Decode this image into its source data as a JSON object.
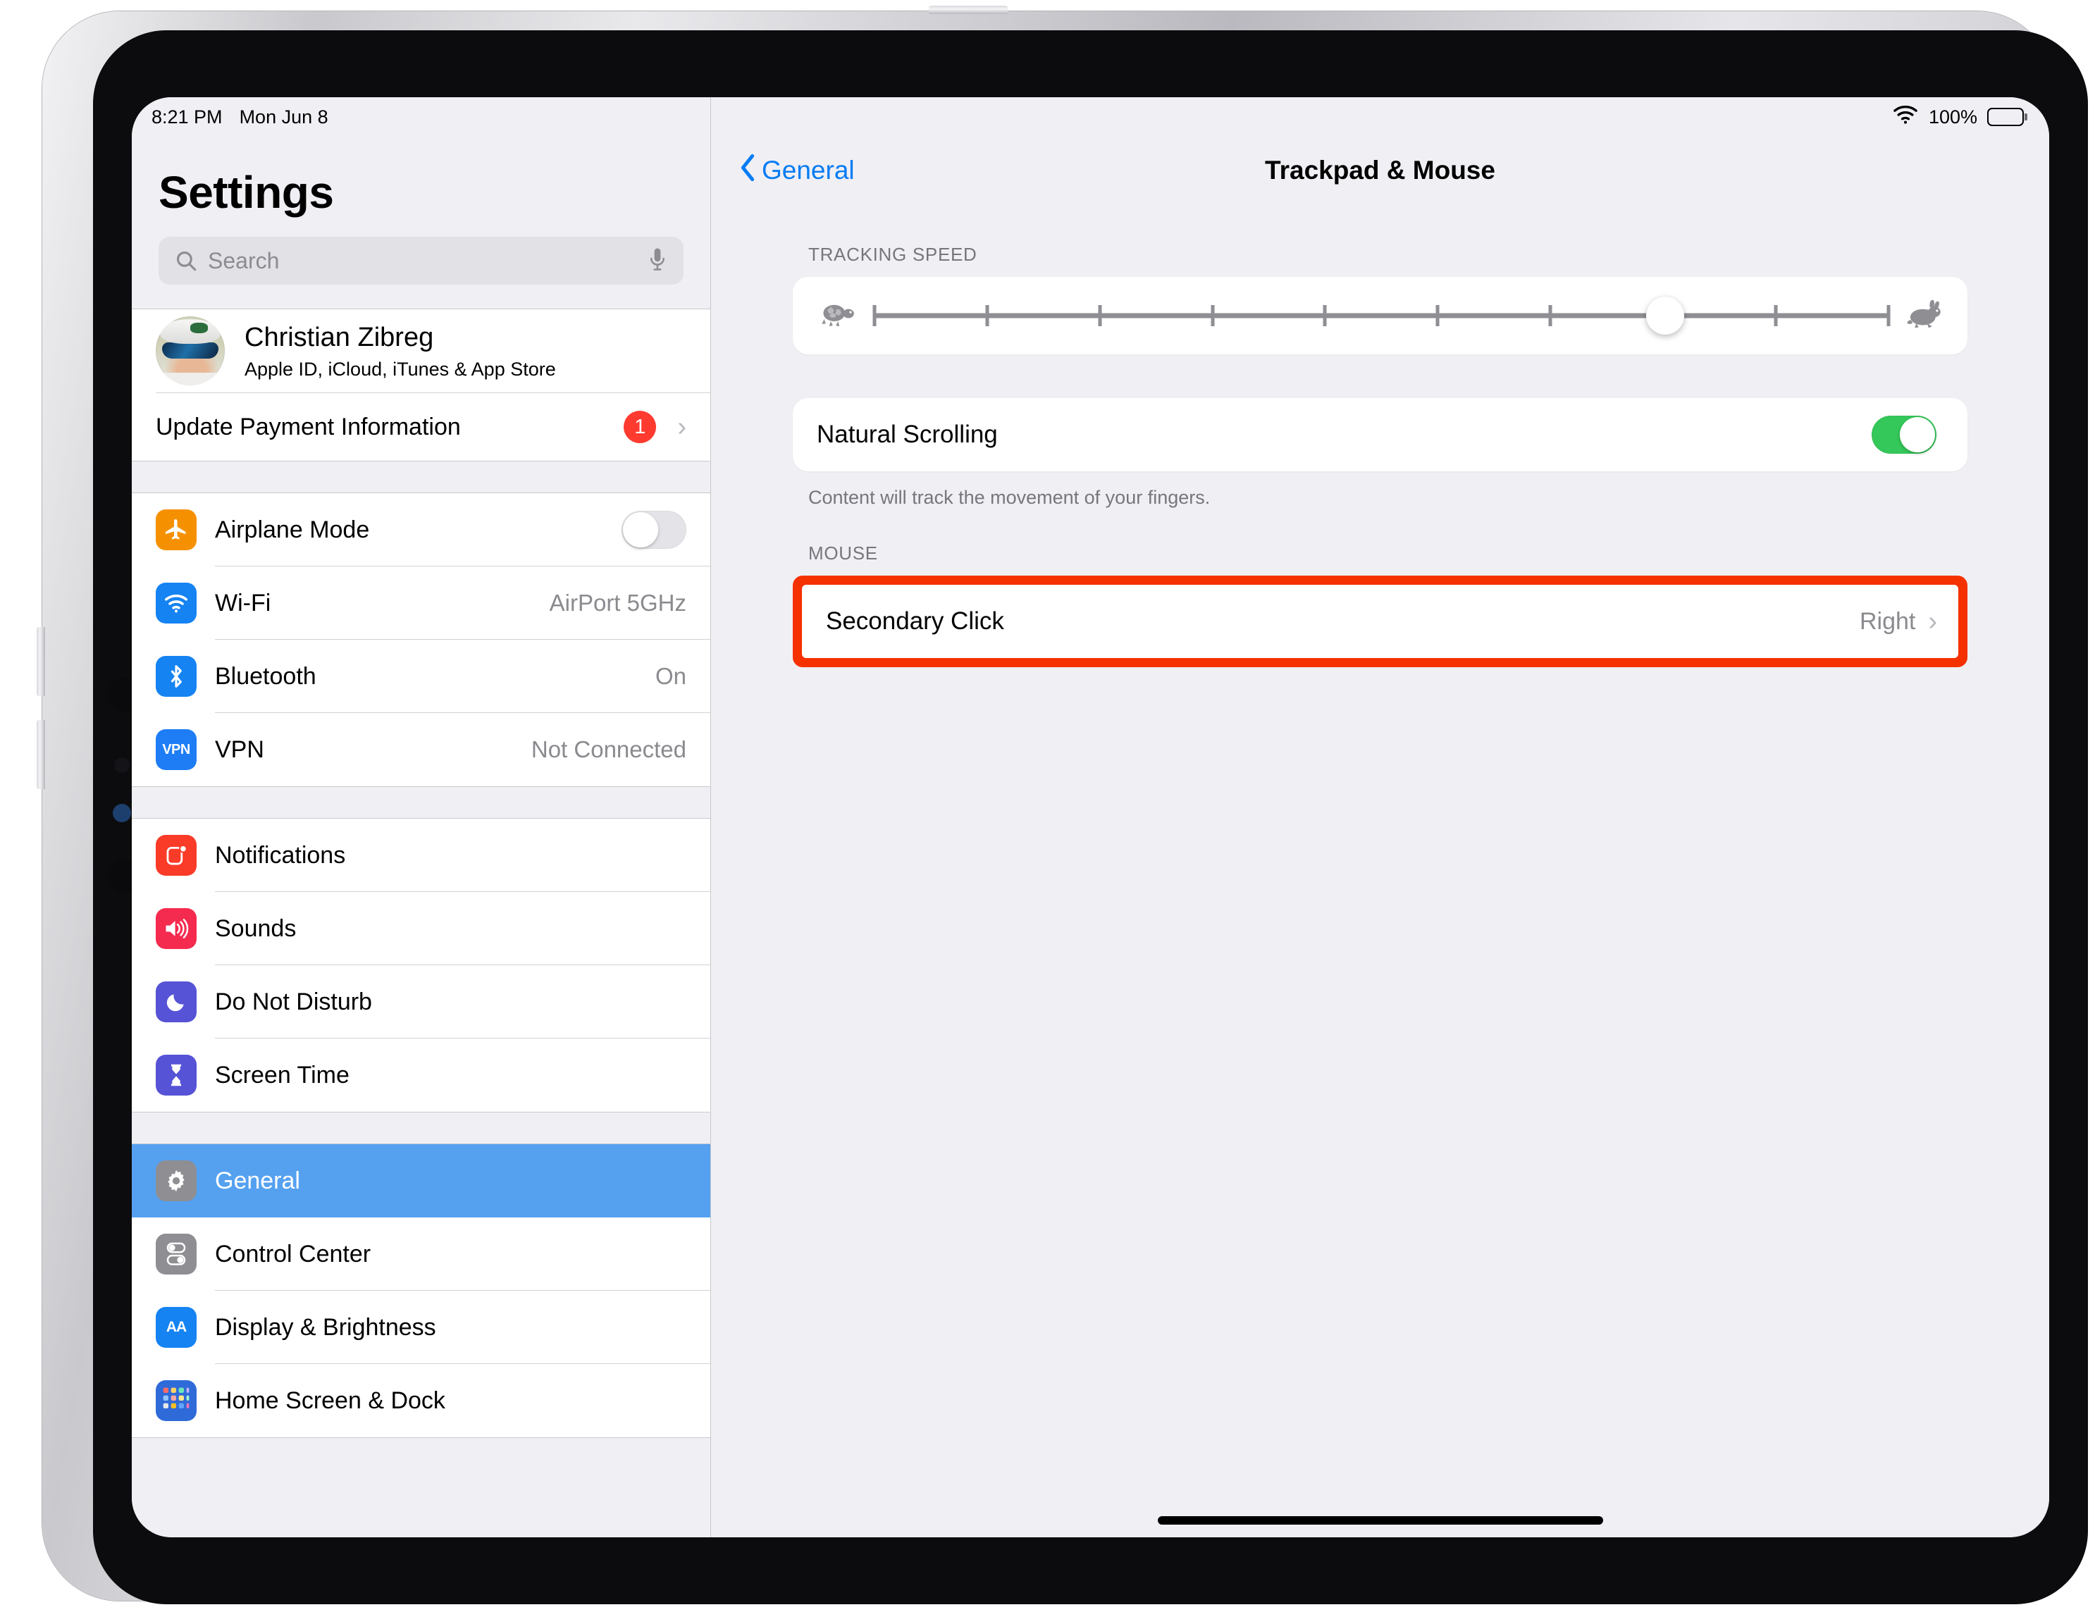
{
  "status_bar": {
    "time": "8:21 PM",
    "date": "Mon Jun 8",
    "wifi_icon": "wifi-icon",
    "battery_percent": "100%",
    "battery_icon": "battery-full-icon"
  },
  "sidebar": {
    "title": "Settings",
    "search": {
      "placeholder": "Search",
      "search_icon": "search-icon",
      "mic_icon": "microphone-icon"
    },
    "account": {
      "name": "Christian Zibreg",
      "subtitle": "Apple ID, iCloud, iTunes & App Store",
      "avatar": "avatar"
    },
    "payment": {
      "label": "Update Payment Information",
      "badge": "1",
      "chevron": "chevron-right-icon"
    },
    "group1": [
      {
        "label": "Airplane Mode",
        "icon": "airplane-icon",
        "icon_color": "#f59100",
        "control": "toggle",
        "toggle_on": false
      },
      {
        "label": "Wi-Fi",
        "icon": "wifi-icon",
        "icon_color": "#1583f2",
        "value": "AirPort 5GHz"
      },
      {
        "label": "Bluetooth",
        "icon": "bluetooth-icon",
        "icon_color": "#1583f2",
        "value": "On"
      },
      {
        "label": "VPN",
        "icon": "vpn-icon",
        "icon_color": "#1e7df5",
        "value": "Not Connected"
      }
    ],
    "group2": [
      {
        "label": "Notifications",
        "icon": "notifications-icon",
        "icon_color": "#f93b28"
      },
      {
        "label": "Sounds",
        "icon": "sounds-icon",
        "icon_color": "#f52a4f"
      },
      {
        "label": "Do Not Disturb",
        "icon": "moon-icon",
        "icon_color": "#5653d6"
      },
      {
        "label": "Screen Time",
        "icon": "hourglass-icon",
        "icon_color": "#5653d6"
      }
    ],
    "group3": [
      {
        "label": "General",
        "icon": "gear-icon",
        "icon_color": "#8e8e93",
        "selected": true
      },
      {
        "label": "Control Center",
        "icon": "control-center-icon",
        "icon_color": "#8e8e93"
      },
      {
        "label": "Display & Brightness",
        "icon": "display-brightness-icon",
        "icon_color": "#1583f2"
      },
      {
        "label": "Home Screen & Dock",
        "icon": "home-screen-dock-icon",
        "icon_color": "#1583f2"
      }
    ]
  },
  "content": {
    "back_label": "General",
    "back_icon": "chevron-left-icon",
    "title": "Trackpad & Mouse",
    "tracking_speed": {
      "header": "TRACKING SPEED",
      "slow_icon": "turtle-icon",
      "fast_icon": "rabbit-icon",
      "ticks": 10,
      "value_index": 8
    },
    "natural_scrolling": {
      "label": "Natural Scrolling",
      "toggle_on": true,
      "footnote": "Content will track the movement of your fingers."
    },
    "mouse": {
      "header": "MOUSE",
      "secondary_click": {
        "label": "Secondary Click",
        "value": "Right",
        "chevron": "chevron-right-icon"
      }
    },
    "home_indicator": "home-indicator"
  },
  "colors": {
    "accent_blue": "#067cf4",
    "selected_blue": "#55a1f0",
    "toggle_green": "#34c759",
    "badge_red": "#ff3b30",
    "highlight_red": "#f53100"
  }
}
